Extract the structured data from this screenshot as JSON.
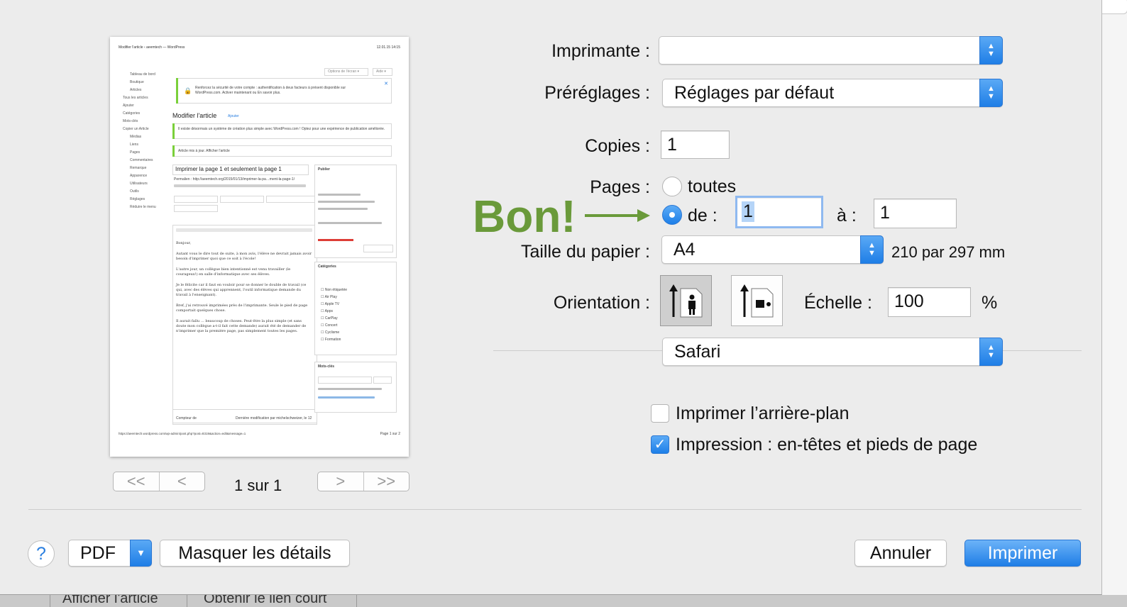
{
  "preview": {
    "header_left": "Modifier l'article ‹ aeemtech — WordPress",
    "header_right": "12.01.15 14:15",
    "sidebar_items": [
      "Tableau de bord",
      "Boutique",
      "Articles",
      "Tous les articles",
      "Ajouter",
      "Catégories",
      "Mots-clés",
      "Copier un Article",
      "Médias",
      "Liens",
      "Pages",
      "Commentaires",
      "Remarque",
      "Apparence",
      "Utilisateurs",
      "Outils",
      "Réglages",
      "Réduire le menu"
    ],
    "screen_options": "Options de l'écran ▾",
    "help_tab": "Aide ▾",
    "notice": "Renforcez la sécurité de votre compte : authentification à deux facteurs à présent disponible sur WordPress.com. Activer maintenant ou En savoir plus.",
    "page_heading": "Modifier l'article",
    "add_link": "Ajouter",
    "notice2": "Il existe désormais un système de création plus simple avec WordPress.com ! Optez pour une expérience de publication améliorée.",
    "notice3": "Article mis à jour. Afficher l'article",
    "post_title": "Imprimer la page 1 et seulement la page 1",
    "permalink": "Permalien : http://aeemtech.org/2015/01/13/imprimer-la-pa…ment-la-page-1/",
    "body_paragraphs": [
      "Bonjour,",
      "Autant vous le dire tout de suite, à mon avis, l'élève ne devrait jamais avoir besoin d'imprimer quoi que ce soit à l'école!",
      "L'autre jour, un collègue bien intentionné est venu travailler (le courageux!) en salle d'informatique avec ses élèves.",
      "Je le félicite car il faut en vouloir pour se donner le double de travail (ce qui, avec des élèves qui apprennent, l'outil informatique demande du travail à l'enseignant).",
      "Bref, j'ai retrouvé imprimées près de l'imprimante. Seule le pied de page comportait quelques chose.",
      "Il aurait fallu … beaucoup de choses. Peut-être la plus simple (et sans doute mon collègue a-t-il fait cette demande) aurait été de demander de n'imprimer que la première page, pas simplement toutes les pages."
    ],
    "publish_box": "Publier",
    "categories_box": "Catégories",
    "categories": [
      "Non étiquetée",
      "Air Play",
      "Apple TV",
      "Apps",
      "CarPlay",
      "Concert",
      "Cyclisme",
      "Formation"
    ],
    "tags_box": "Mots-clés",
    "footer_left": "https://aeemtech.wordpress.com/wp-admin/post.php?post=8319&action=edit&message=1",
    "footer_right": "Page 1 sur 2",
    "word_count": "Compteur de",
    "last_modified": "Dernière modification par michelschweizer, le 12"
  },
  "pager": {
    "first": "<<",
    "prev": "<",
    "next": ">",
    "last": ">>",
    "label": "1 sur 1"
  },
  "form": {
    "printer_label": "Imprimante :",
    "printer_value": "",
    "presets_label": "Préréglages :",
    "presets_value": "Réglages par défaut",
    "copies_label": "Copies :",
    "copies_value": "1",
    "pages_label": "Pages :",
    "pages_all": "toutes",
    "pages_from": "de :",
    "pages_from_value": "1",
    "pages_to": "à :",
    "pages_to_value": "1",
    "paper_label": "Taille du papier :",
    "paper_value": "A4",
    "paper_dims": "210 par 297 mm",
    "orientation_label": "Orientation :",
    "scale_label": "Échelle :",
    "scale_value": "100",
    "scale_unit": "%",
    "section_value": "Safari",
    "print_background": "Imprimer l’arrière-plan",
    "print_headers": "Impression : en-têtes et pieds de page"
  },
  "annotation": "Bon!",
  "footer": {
    "help": "?",
    "pdf": "PDF",
    "hide_details": "Masquer les détails",
    "cancel": "Annuler",
    "print": "Imprimer"
  },
  "background": {
    "tab1": "Afficher l'article",
    "tab2": "Obtenir le lien court"
  },
  "colors": {
    "accent": "#1f7ee6",
    "annotation": "#6a9a3a"
  }
}
